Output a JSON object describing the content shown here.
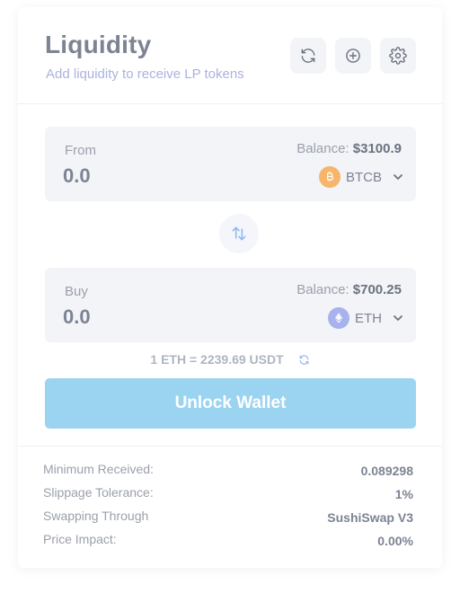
{
  "header": {
    "title": "Liquidity",
    "subtitle": "Add liquidity to receive LP tokens",
    "buttons": [
      "refresh-icon",
      "plus-circle-icon",
      "gear-icon"
    ]
  },
  "from": {
    "label": "From",
    "balance_label": "Balance:",
    "balance_value": "$3100.9",
    "amount": "0.0",
    "token": "BTCB",
    "token_color": "#f7b46a"
  },
  "buy": {
    "label": "Buy",
    "balance_label": "Balance:",
    "balance_value": "$700.25",
    "amount": "0.0",
    "token": "ETH",
    "token_color": "#a7b2ee"
  },
  "rate": {
    "text": "1 ETH = 2239.69 USDT"
  },
  "unlock_label": "Unlock Wallet",
  "details": [
    {
      "label": "Minimum Received:",
      "value": "0.089298"
    },
    {
      "label": "Slippage Tolerance:",
      "value": "1%"
    },
    {
      "label": "Swapping Through",
      "value": "SushiSwap V3"
    },
    {
      "label": "Price Impact:",
      "value": "0.00%"
    }
  ],
  "colors": {
    "accent": "#9bd4f1",
    "swap_icon": "#8fb5ef",
    "panel_bg": "#f3f4f7"
  }
}
